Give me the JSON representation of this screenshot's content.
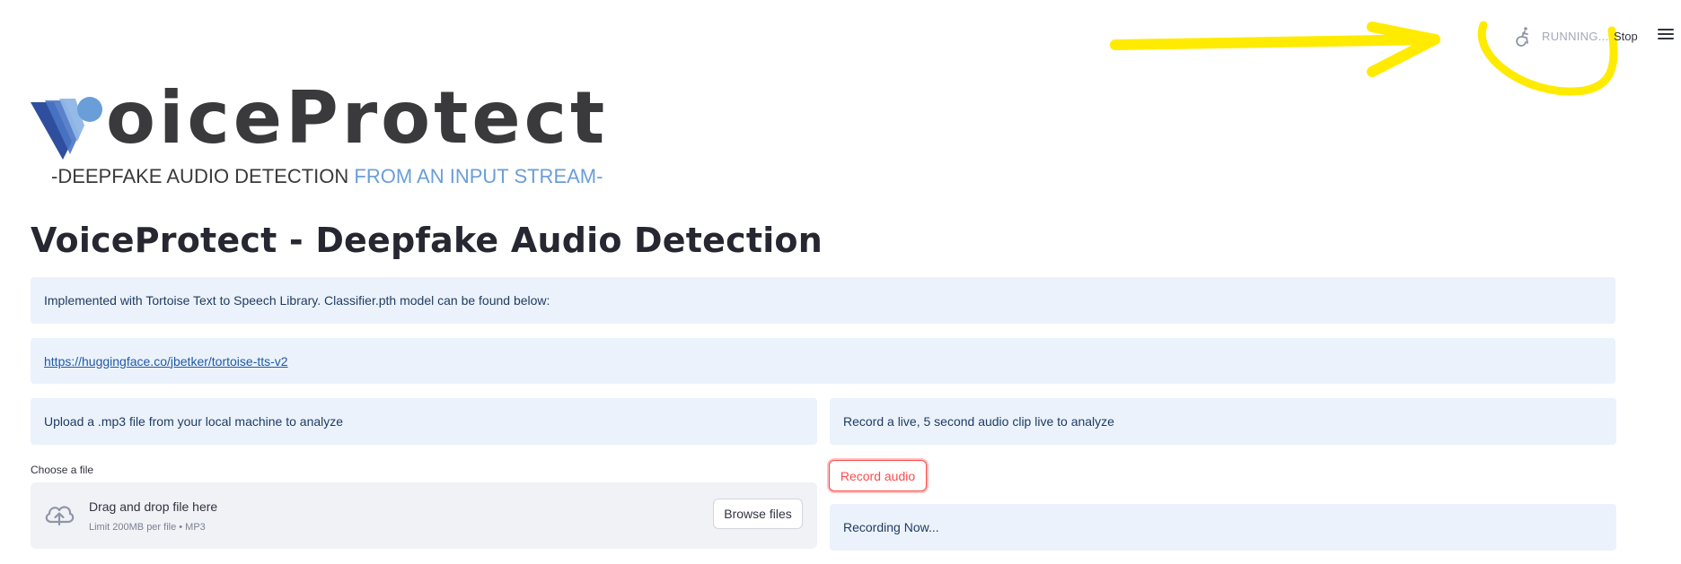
{
  "toolbar": {
    "status_text": "RUNNING...",
    "stop_label": "Stop",
    "status_icon": "running-person-icon",
    "menu_icon": "hamburger-menu-icon"
  },
  "annotation": {
    "color": "#ffeb00"
  },
  "logo": {
    "wordmark": "oiceProtect",
    "tagline_dark": "-DEEPFAKE AUDIO DETECTION ",
    "tagline_blue": "FROM AN INPUT STREAM-",
    "colors": {
      "dark": "#3a3a3c",
      "blue": "#6a9ed8",
      "navy": "#2f4f9e"
    }
  },
  "title": "VoiceProtect - Deepfake Audio Detection",
  "info": {
    "implemented": "Implemented with Tortoise Text to Speech Library. Classifier.pth model can be found below:",
    "link": "https://huggingface.co/jbetker/tortoise-tts-v2",
    "upload_prompt": "Upload a .mp3 file from your local machine to analyze",
    "record_prompt": "Record a live, 5 second audio clip live to analyze",
    "recording_status": "Recording Now..."
  },
  "uploader": {
    "label": "Choose a file",
    "drag_text": "Drag and drop file here",
    "limit_text": "Limit 200MB per file • MP3",
    "browse_label": "Browse files",
    "icon": "cloud-upload-icon"
  },
  "record": {
    "button_label": "Record audio"
  },
  "colors": {
    "info_bg": "#ebf2fc",
    "accent_red": "#ff4b4b",
    "dropzone_bg": "#f0f2f6"
  }
}
